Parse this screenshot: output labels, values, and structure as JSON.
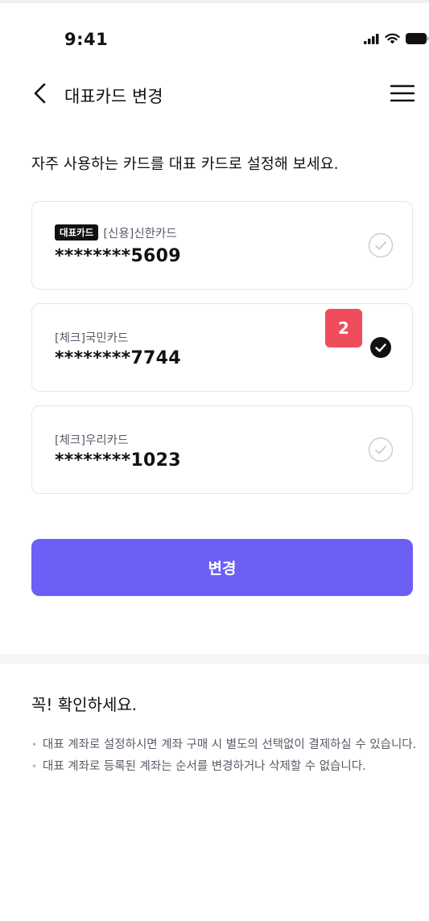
{
  "status_bar": {
    "time": "9:41"
  },
  "header": {
    "title": "대표카드 변경"
  },
  "headline": "자주 사용하는 카드를 대표 카드로 설정해 보세요.",
  "cards": [
    {
      "badge": "대표카드",
      "name": "[신용]신한카드",
      "number": "********5609",
      "selected": false
    },
    {
      "name": "[체크]국민카드",
      "number": "********7744",
      "selected": true
    },
    {
      "name": "[체크]우리카드",
      "number": "********1023",
      "selected": false
    }
  ],
  "step_badge": "2",
  "change_button": {
    "label": "변경"
  },
  "notice": {
    "title": "꼭! 확인하세요.",
    "items": [
      "대표 계좌로 설정하시면 계좌 구매 시 별도의 선택없이 결제하실 수 있습니다.",
      "대표 계좌로 등록된 계좌는 순서를 변경하거나 삭제할 수 없습니다."
    ]
  },
  "icons": {
    "back": "chevron-left-icon",
    "menu": "hamburger-menu-icon",
    "check_unselected": "check-circle-outline-icon",
    "check_selected": "check-circle-filled-icon"
  },
  "colors": {
    "accent": "#6c5ff5",
    "step_badge": "#ef4d5b",
    "selected_check": "#111111"
  }
}
